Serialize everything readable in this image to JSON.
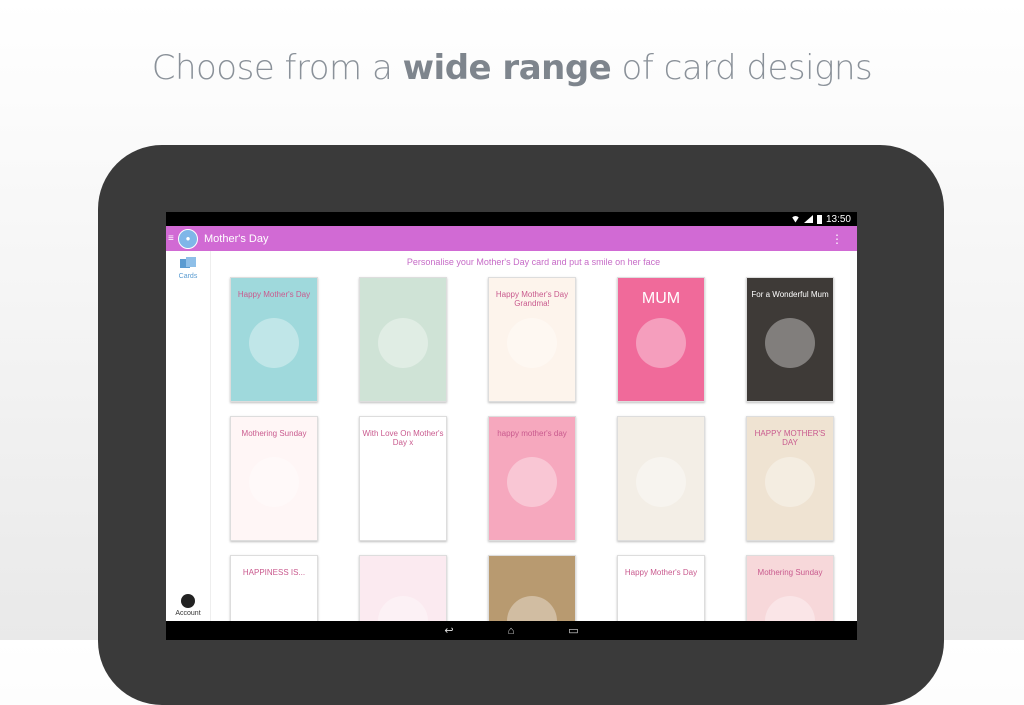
{
  "headline": {
    "pre": "Choose from a ",
    "bold": "wide range",
    "post": " of card designs"
  },
  "status": {
    "time": "13:50"
  },
  "appbar": {
    "title": "Mother's Day",
    "overflow": "⋮",
    "menu": "≡"
  },
  "sidebar": {
    "cards_label": "Cards",
    "account_label": "Account"
  },
  "tagline": "Personalise your Mother's Day card and put a smile on her face",
  "cards": [
    {
      "text": "Happy Mother's Day",
      "bg": "#9fd9dc"
    },
    {
      "text": "",
      "bg": "#cfe3d6"
    },
    {
      "text": "Happy Mother's Day Grandma!",
      "bg": "#fdf4ec"
    },
    {
      "text": "MUM",
      "bg": "#f06a9a"
    },
    {
      "text": "For a Wonderful Mum",
      "bg": "#3e3a37"
    },
    {
      "text": "Mothering Sunday",
      "bg": "#fff6f6"
    },
    {
      "text": "With Love On Mother's Day x",
      "bg": "#ffffff"
    },
    {
      "text": "happy mother's day",
      "bg": "#f6a8be"
    },
    {
      "text": "",
      "bg": "#f3eee6"
    },
    {
      "text": "HAPPY MOTHER'S DAY",
      "bg": "#efe3d2"
    },
    {
      "text": "HAPPINESS IS...",
      "bg": "#ffffff"
    },
    {
      "text": "",
      "bg": "#fbeaf0"
    },
    {
      "text": "",
      "bg": "#b89a70"
    },
    {
      "text": "Happy Mother's Day",
      "bg": "#ffffff"
    },
    {
      "text": "Mothering Sunday",
      "bg": "#f7d8da"
    }
  ],
  "navbar": {
    "back": "↩",
    "home": "⌂",
    "recents": "▭"
  },
  "colors": {
    "accent": "#d16ad4",
    "tagline": "#c66bc7",
    "cards_icon": "#5a9bd1"
  },
  "icons": [
    "menu-icon",
    "app-logo-icon",
    "overflow-icon",
    "cards-icon",
    "account-icon",
    "back-icon",
    "home-icon",
    "recents-icon",
    "wifi-icon",
    "signal-icon",
    "battery-icon"
  ]
}
